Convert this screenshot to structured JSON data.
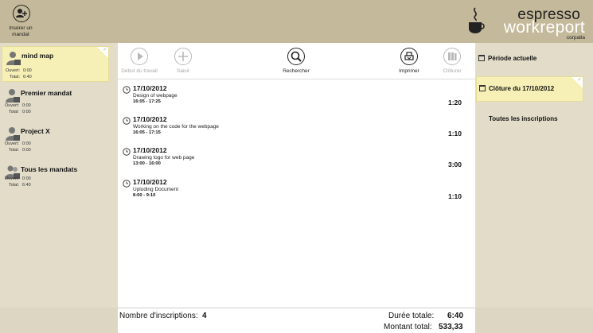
{
  "header": {
    "add_mandate_label": "Insérer un mandat",
    "logo_top": "espresso",
    "logo_main": "workreport",
    "logo_sub": "corpatla"
  },
  "mandates": [
    {
      "name": "mind map",
      "open_label": "Ouvert:",
      "open": "0:00",
      "total_label": "Total:",
      "total": "6:40",
      "selected": true
    },
    {
      "name": "Premier mandat",
      "open_label": "Ouvert:",
      "open": "0:00",
      "total_label": "Total:",
      "total": "0:00",
      "selected": false
    },
    {
      "name": "Project X",
      "open_label": "Ouvert:",
      "open": "0:00",
      "total_label": "Total:",
      "total": "0:00",
      "selected": false
    },
    {
      "name": "Tous les mandats",
      "open_label": "Ouvert:",
      "open": "0:00",
      "total_label": "Total:",
      "total": "6:40",
      "selected": false
    }
  ],
  "toolbar": {
    "start_label": "Début du travail",
    "enter_label": "Saisir",
    "search_label": "Rechercher",
    "print_label": "Imprimer",
    "close_label": "Clôturer"
  },
  "entries": [
    {
      "date": "17/10/2012",
      "desc": "Design of webpage",
      "range": "16:05 - 17:25",
      "duration": "1:20"
    },
    {
      "date": "17/10/2012",
      "desc": "Working on the code for the webpage",
      "range": "16:05 - 17:15",
      "duration": "1:10"
    },
    {
      "date": "17/10/2012",
      "desc": "Drawing logo for web page",
      "range": "13:00 - 16:00",
      "duration": "3:00"
    },
    {
      "date": "17/10/2012",
      "desc": "Uploding Document",
      "range": "8:00 - 9:10",
      "duration": "1:10"
    }
  ],
  "periods": {
    "current": "Période actuelle",
    "closing": "Clôture du 17/10/2012",
    "all": "Toutes les inscriptions"
  },
  "footer": {
    "count_label": "Nombre d'inscriptions:",
    "count": "4",
    "duration_label": "Durée totale:",
    "duration": "6:40",
    "amount_label": "Montant total:",
    "amount": "533,33"
  },
  "colors": {
    "header": "#c4b99a",
    "sidebar": "#e2dcc9",
    "selected": "#f6efb6"
  }
}
